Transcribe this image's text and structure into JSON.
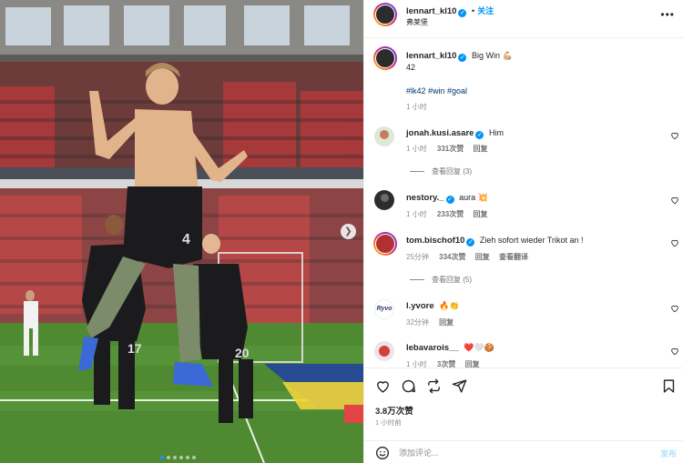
{
  "post_owner": {
    "username": "lennart_kl10",
    "follow_label": "关注",
    "location": "弗莱堡"
  },
  "caption": {
    "username": "lennart_kl10",
    "text": "Big Win 💪🏼",
    "line2": "42",
    "hashtags": "#lk42 #win #goal",
    "time": "1 小时"
  },
  "comments": [
    {
      "username": "jonah.kusi.asare",
      "verified": true,
      "text": "Him",
      "time": "1 小时",
      "likes": "331次赞",
      "reply": "回复",
      "view_replies": "查看回复 (3)",
      "extra": ""
    },
    {
      "username": "nestory._",
      "verified": true,
      "text": "aura 💥",
      "time": "1 小时",
      "likes": "233次赞",
      "reply": "回复",
      "view_replies": "",
      "extra": ""
    },
    {
      "username": "tom.bischof10",
      "verified": true,
      "text": "Zieh sofort wieder Trikot an !",
      "time": "25分钟",
      "likes": "334次赞",
      "reply": "回复",
      "view_replies": "查看回复 (5)",
      "extra": "查看翻译"
    },
    {
      "username": "l.yvore",
      "verified": false,
      "text": "🔥👏",
      "time": "32分钟",
      "likes": "",
      "reply": "回复",
      "view_replies": "",
      "extra": ""
    },
    {
      "username": "lebavarois__",
      "verified": false,
      "text": "❤️🤍🍪",
      "time": "1 小时",
      "likes": "3次赞",
      "reply": "回复",
      "view_replies": "",
      "extra": ""
    }
  ],
  "engagement": {
    "likes": "3.8万次赞",
    "time": "1 小时前"
  },
  "comment_box": {
    "placeholder": "添加评论...",
    "post_label": "发布"
  },
  "colors": {
    "accent": "#0095f6",
    "link": "#00376b",
    "muted": "#8e8e8e",
    "border": "#efefef"
  },
  "carousel": {
    "total_slides": 6,
    "active_index": 0
  },
  "icons": {
    "like": "heart-icon",
    "comment": "comment-icon",
    "repost": "repost-icon",
    "share": "share-icon",
    "save": "bookmark-icon",
    "emoji": "emoji-icon",
    "next": "chevron-right-icon"
  }
}
